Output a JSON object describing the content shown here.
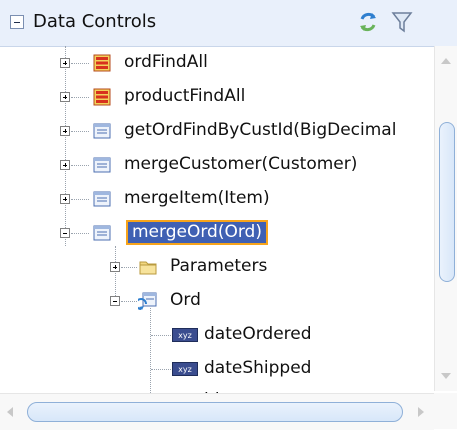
{
  "header": {
    "title": "Data Controls",
    "refresh_icon": "refresh-icon",
    "filter_icon": "filter-icon"
  },
  "tree": {
    "items": [
      {
        "label": "ordFindAll",
        "icon": "collection-icon",
        "expanded": false,
        "selected": false
      },
      {
        "label": "productFindAll",
        "icon": "collection-icon",
        "expanded": false,
        "selected": false
      },
      {
        "label": "getOrdFindByCustId(BigDecimal",
        "icon": "method-icon",
        "expanded": false,
        "selected": false
      },
      {
        "label": "mergeCustomer(Customer)",
        "icon": "method-icon",
        "expanded": false,
        "selected": false
      },
      {
        "label": "mergeItem(Item)",
        "icon": "method-icon",
        "expanded": false,
        "selected": false
      },
      {
        "label": "mergeOrd(Ord)",
        "icon": "method-icon",
        "expanded": true,
        "selected": true
      },
      {
        "label": "Parameters",
        "icon": "folder-icon",
        "expanded": false,
        "selected": false
      },
      {
        "label": "Ord",
        "icon": "return-object-icon",
        "expanded": true,
        "selected": false
      },
      {
        "label": "dateOrdered",
        "icon": "attribute-icon",
        "selected": false
      },
      {
        "label": "dateShipped",
        "icon": "attribute-icon",
        "selected": false
      },
      {
        "label": "id",
        "icon": "attribute-icon",
        "selected": false
      }
    ]
  },
  "colors": {
    "header_bg": "#e9f0fb",
    "selection_bg": "#3f60b3",
    "selection_outline": "#f7a41b",
    "scroll_thumb_border": "#8fb0d8"
  }
}
